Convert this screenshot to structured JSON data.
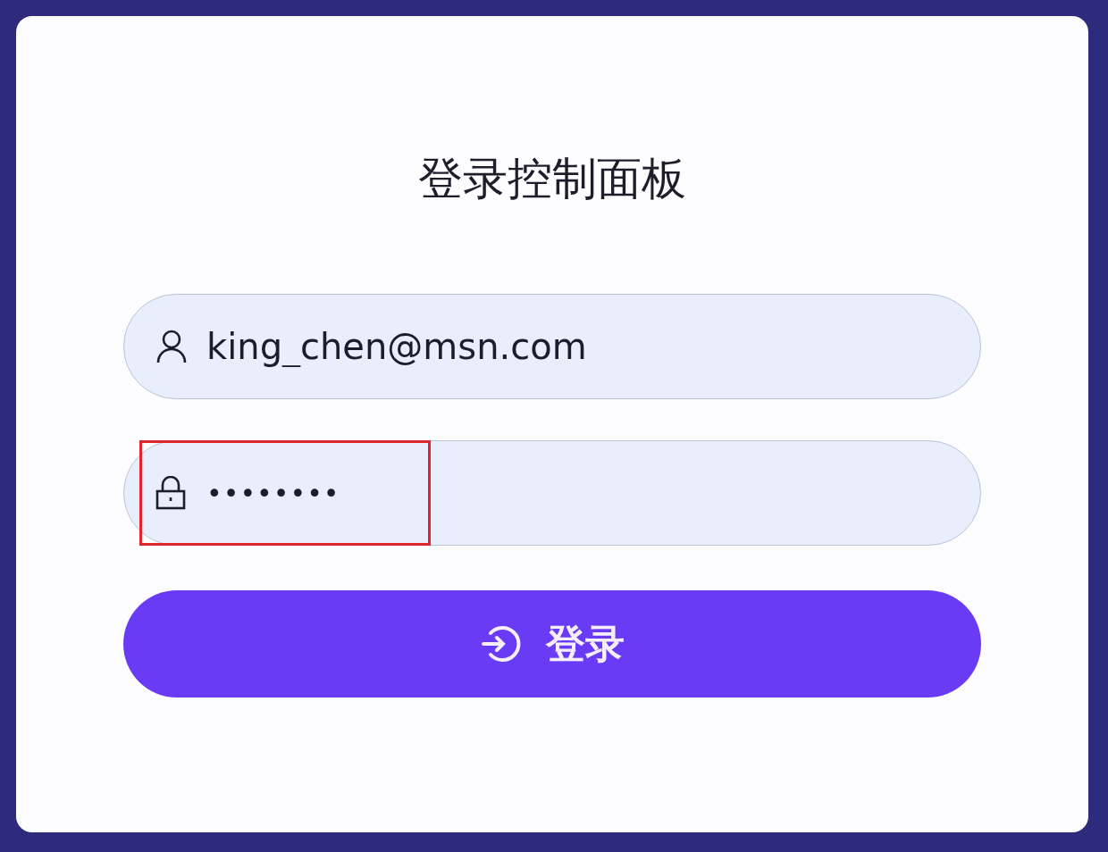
{
  "title": "登录控制面板",
  "fields": [
    {
      "kind": "user",
      "value": "king_chen@msn.com",
      "highlighted": false
    },
    {
      "kind": "password",
      "value": "••••••••",
      "highlighted": true
    }
  ],
  "submit": {
    "label": "登录"
  }
}
